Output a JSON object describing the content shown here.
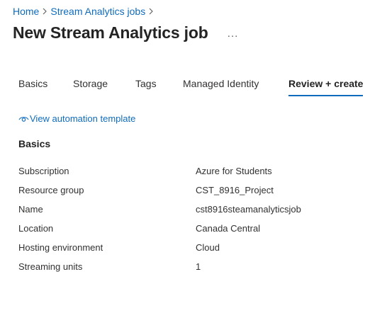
{
  "breadcrumb": {
    "items": [
      "Home",
      "Stream Analytics jobs"
    ]
  },
  "header": {
    "title": "New Stream Analytics job",
    "more_label": "..."
  },
  "tabs": [
    {
      "label": "Basics",
      "active": false
    },
    {
      "label": "Storage",
      "active": false
    },
    {
      "label": "Tags",
      "active": false
    },
    {
      "label": "Managed Identity",
      "active": false
    },
    {
      "label": "Review + create",
      "active": true
    }
  ],
  "automation": {
    "icon": "eye-icon",
    "label": "View automation template"
  },
  "section": {
    "title": "Basics",
    "rows": [
      {
        "key": "Subscription",
        "value": "Azure for Students"
      },
      {
        "key": "Resource group",
        "value": "CST_8916_Project"
      },
      {
        "key": "Name",
        "value": "cst8916steamanalyticsjob"
      },
      {
        "key": "Location",
        "value": "Canada Central"
      },
      {
        "key": "Hosting environment",
        "value": "Cloud"
      },
      {
        "key": "Streaming units",
        "value": "1"
      }
    ]
  },
  "colors": {
    "link": "#0f6cbd",
    "text": "#323130",
    "heading": "#242424"
  }
}
